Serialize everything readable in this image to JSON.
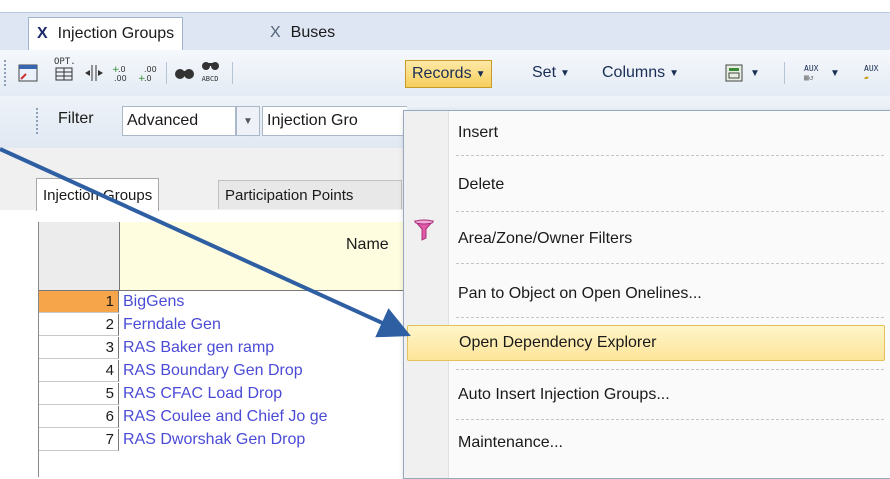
{
  "tabs": [
    {
      "label": "Injection Groups",
      "close": "X",
      "active": true
    },
    {
      "label": "Buses",
      "close": "X",
      "active": false
    }
  ],
  "toolbar": {
    "icons": [
      "grid-icon",
      "opt-grid-icon",
      "column-split-icon",
      "decimal-increase-icon",
      "decimal-decrease-icon",
      "find-icon",
      "find-abcd-icon",
      "export-icon",
      "aux-icon",
      "aux-load-icon"
    ],
    "opt_label": "OPT.",
    "abcd_label": "ABCD",
    "aux_label": "AUX",
    "records_label": "Records",
    "set_label": "Set",
    "columns_label": "Columns"
  },
  "filter": {
    "label": "Filter",
    "mode": "Advanced",
    "object": "Injection Gro"
  },
  "subtabs": [
    "Injection Groups",
    "Participation Points"
  ],
  "grid": {
    "column_header": "Name",
    "rows": [
      {
        "num": "1",
        "name": "BigGens"
      },
      {
        "num": "2",
        "name": "Ferndale Gen"
      },
      {
        "num": "3",
        "name": "RAS Baker gen ramp"
      },
      {
        "num": "4",
        "name": "RAS Boundary Gen Drop"
      },
      {
        "num": "5",
        "name": "RAS CFAC Load Drop"
      },
      {
        "num": "6",
        "name": "RAS Coulee and Chief Jo ge"
      },
      {
        "num": "7",
        "name": "RAS Dworshak Gen Drop"
      }
    ]
  },
  "records_menu": {
    "items": [
      {
        "label": "Insert"
      },
      {
        "label": "Delete"
      },
      {
        "label": "Area/Zone/Owner Filters"
      },
      {
        "label": "Pan to Object on Open Onelines..."
      },
      {
        "label": "Open Dependency Explorer",
        "highlighted": true
      },
      {
        "label": "Auto Insert Injection Groups..."
      },
      {
        "label": "Maintenance..."
      }
    ]
  },
  "colors": {
    "arrow": "#2e5fa3",
    "highlight": "#fde59a",
    "row_link": "#4b4bd6",
    "selected_row": "#f7a54a"
  }
}
